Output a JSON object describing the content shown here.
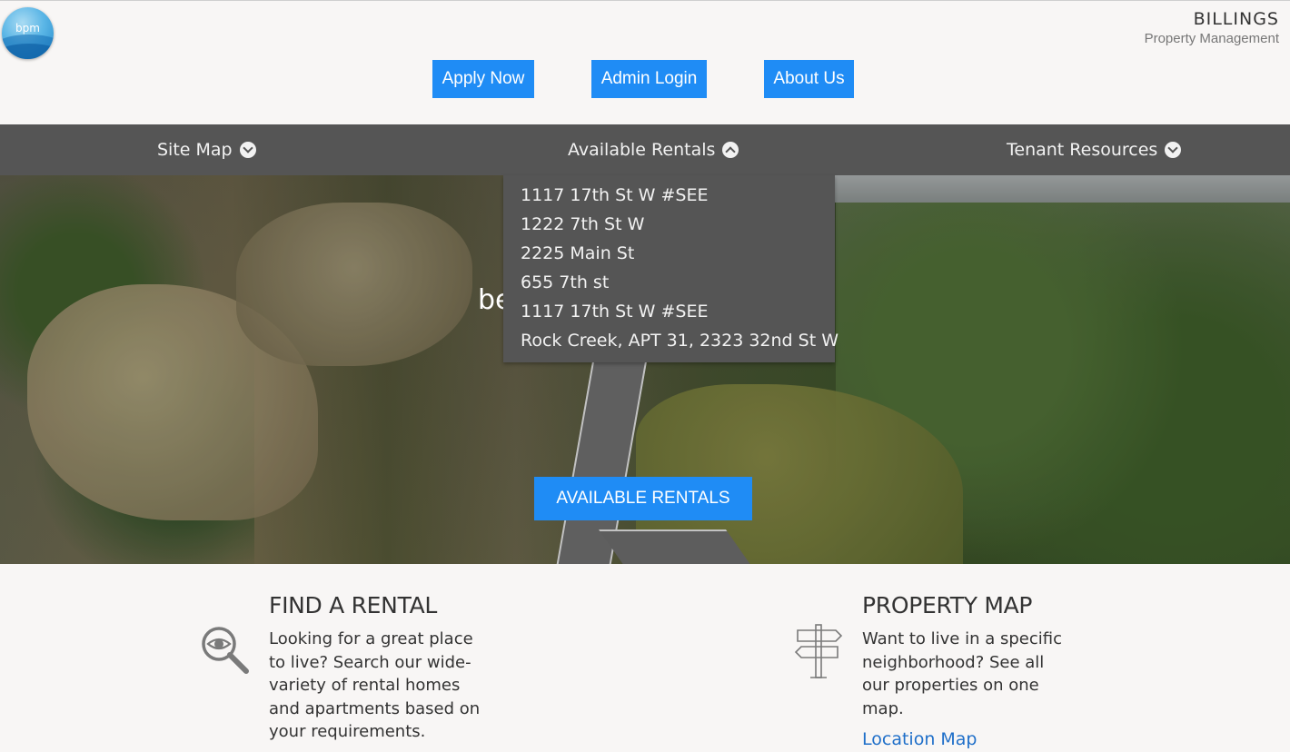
{
  "logo": {
    "text": "bpm"
  },
  "brand": {
    "name": "BILLINGS",
    "subtitle": "Property Management"
  },
  "top_buttons": {
    "apply": "Apply Now",
    "admin": "Admin Login",
    "about": "About Us"
  },
  "nav": {
    "site_map": "Site Map",
    "available_rentals": "Available Rentals",
    "tenant_resources": "Tenant Resources"
  },
  "rentals_dropdown": {
    "items": [
      "1117 17th St W #SEE",
      "1222 7th St W",
      "2225 Main St",
      "655 7th st",
      "1117 17th St W #SEE",
      "Rock Creek, APT 31, 2323 32nd St W"
    ]
  },
  "hero": {
    "partial_text": "be",
    "button": "AVAILABLE RENTALS"
  },
  "features": {
    "rental": {
      "title": "FIND A RENTAL",
      "text": "Looking for a great place to live? Search our wide-variety of rental homes and apartments based on your requirements."
    },
    "map": {
      "title": "PROPERTY MAP",
      "text": "Want to live in a specific neighborhood? See all our properties on one map.",
      "link": "Location Map"
    }
  },
  "colors": {
    "accent": "#1f8cf5",
    "nav_bg": "#555555",
    "link": "#1f6fc9"
  }
}
